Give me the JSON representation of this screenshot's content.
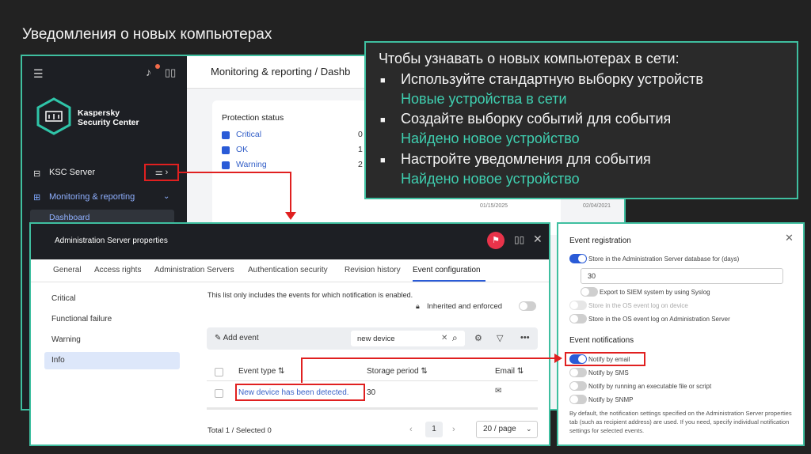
{
  "slide": {
    "title": "Уведомления о новых компьютерах"
  },
  "ksc": {
    "logo_line1": "Kaspersky",
    "logo_line2": "Security Center",
    "ksc_server": "KSC Server",
    "monitoring": "Monitoring & reporting",
    "dashboard": "Dashboard",
    "breadcrumb": "Monitoring & reporting  /  Dashb",
    "protection_status": "Protection status",
    "statuses": [
      {
        "label": "Critical",
        "value": "0"
      },
      {
        "label": "OK",
        "value": "1"
      },
      {
        "label": "Warning",
        "value": "2"
      }
    ],
    "date1": "01/15/2025",
    "date2": "02/04/2021"
  },
  "callout": {
    "intro": "Чтобы узнавать о новых компьютерах в сети:",
    "items": [
      {
        "text": "Используйте стандартную выборку устройств",
        "highlight": "Новые устройства в сети"
      },
      {
        "text": "Создайте выборку событий для события",
        "highlight": "Найдено новое устройство"
      },
      {
        "text": "Настройте уведомления для события",
        "highlight": "Найдено новое устройство"
      }
    ],
    "bullet": "■",
    "text_color": "#f4f4f4",
    "highlight_color": "#3fcfb0"
  },
  "dialog": {
    "title": "Administration Server properties",
    "tabs": [
      "General",
      "Access rights",
      "Administration Servers",
      "Authentication security",
      "Revision history",
      "Event configuration"
    ],
    "active_tab": "Event configuration",
    "severities": [
      "Critical",
      "Functional failure",
      "Warning",
      "Info"
    ],
    "selected_severity": "Info",
    "note": "This list only includes the events for which notification is enabled.",
    "inherited": "Inherited and enforced",
    "add_event": "Add event",
    "search_value": "new device",
    "columns": {
      "event_type": "Event type",
      "storage": "Storage period",
      "email": "Email"
    },
    "row": {
      "event": "New device has been detected.",
      "storage": "30"
    },
    "total": "Total 1 / Selected 0",
    "page": "1",
    "page_size": "20 / page"
  },
  "panel": {
    "registration": "Event registration",
    "store_db": "Store in the Administration Server database for (days)",
    "days": "30",
    "siem": "Export to SIEM system by using Syslog",
    "os_log_device": "Store in the OS event log on device",
    "os_log_server": "Store in the OS event log on Administration Server",
    "notifications": "Event notifications",
    "email": "Notify by email",
    "sms": "Notify by SMS",
    "script": "Notify by running an executable file or script",
    "snmp": "Notify by SNMP",
    "note": "By default, the notification settings specified on the Administration Server properties tab (such as recipient address) are used. If you need, specify individual notification settings for selected events."
  },
  "colors": {
    "frame": "#3fbfa0",
    "highlight_box": "#e02020",
    "accent": "#2a5bd7"
  }
}
